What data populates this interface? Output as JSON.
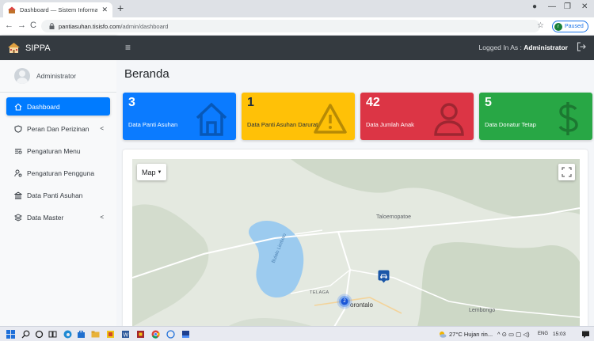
{
  "browser": {
    "tab_title": "Dashboard — Sistem Informasi P",
    "new_tab": "+",
    "url_host": "pantiasuhan.tisisfo.com",
    "url_path": "/admin/dashboard",
    "profile_initial": "r",
    "profile_status": "Paused"
  },
  "app": {
    "brand": "SIPPA",
    "user": "Administrator",
    "logged_in_prefix": "Logged In As : ",
    "logged_in_user": "Administrator",
    "hamburger": "≡"
  },
  "sidebar": {
    "items": [
      {
        "label": "Dashboard",
        "icon": "home-icon",
        "active": true,
        "arrow": ""
      },
      {
        "label": "Peran Dan Perizinan",
        "icon": "shield-icon",
        "active": false,
        "arrow": "<"
      },
      {
        "label": "Pengaturan Menu",
        "icon": "menu-settings-icon",
        "active": false,
        "arrow": ""
      },
      {
        "label": "Pengaturan Pengguna",
        "icon": "user-settings-icon",
        "active": false,
        "arrow": ""
      },
      {
        "label": "Data Panti Asuhan",
        "icon": "building-icon",
        "active": false,
        "arrow": ""
      },
      {
        "label": "Data Master",
        "icon": "layers-icon",
        "active": false,
        "arrow": "<"
      }
    ]
  },
  "page": {
    "title": "Beranda"
  },
  "info_boxes": [
    {
      "value": "3",
      "label": "Data Panti Asuhan",
      "color": "#0b7bff",
      "icon": "home-icon"
    },
    {
      "value": "1",
      "label": "Data Panti Asuhan Darurat",
      "color": "#ffc107",
      "icon": "warning-icon"
    },
    {
      "value": "42",
      "label": "Data Jumlah Anak",
      "color": "#dc3545",
      "icon": "user-icon"
    },
    {
      "value": "5",
      "label": "Data Donatur Tetap",
      "color": "#28a745",
      "icon": "dollar-icon"
    }
  ],
  "map": {
    "type_button": "Map",
    "labels": {
      "taloemopatoe": "Taloemopatoe",
      "lake": "Bulalo Limboto",
      "telaga": "TELAGA",
      "gorontalo": "orontalo",
      "lembongo": "Lembongo"
    },
    "cluster_count": "2"
  },
  "taskbar": {
    "weather": "27°C Hujan rin...",
    "lang": "ENG",
    "time": "15:03"
  }
}
